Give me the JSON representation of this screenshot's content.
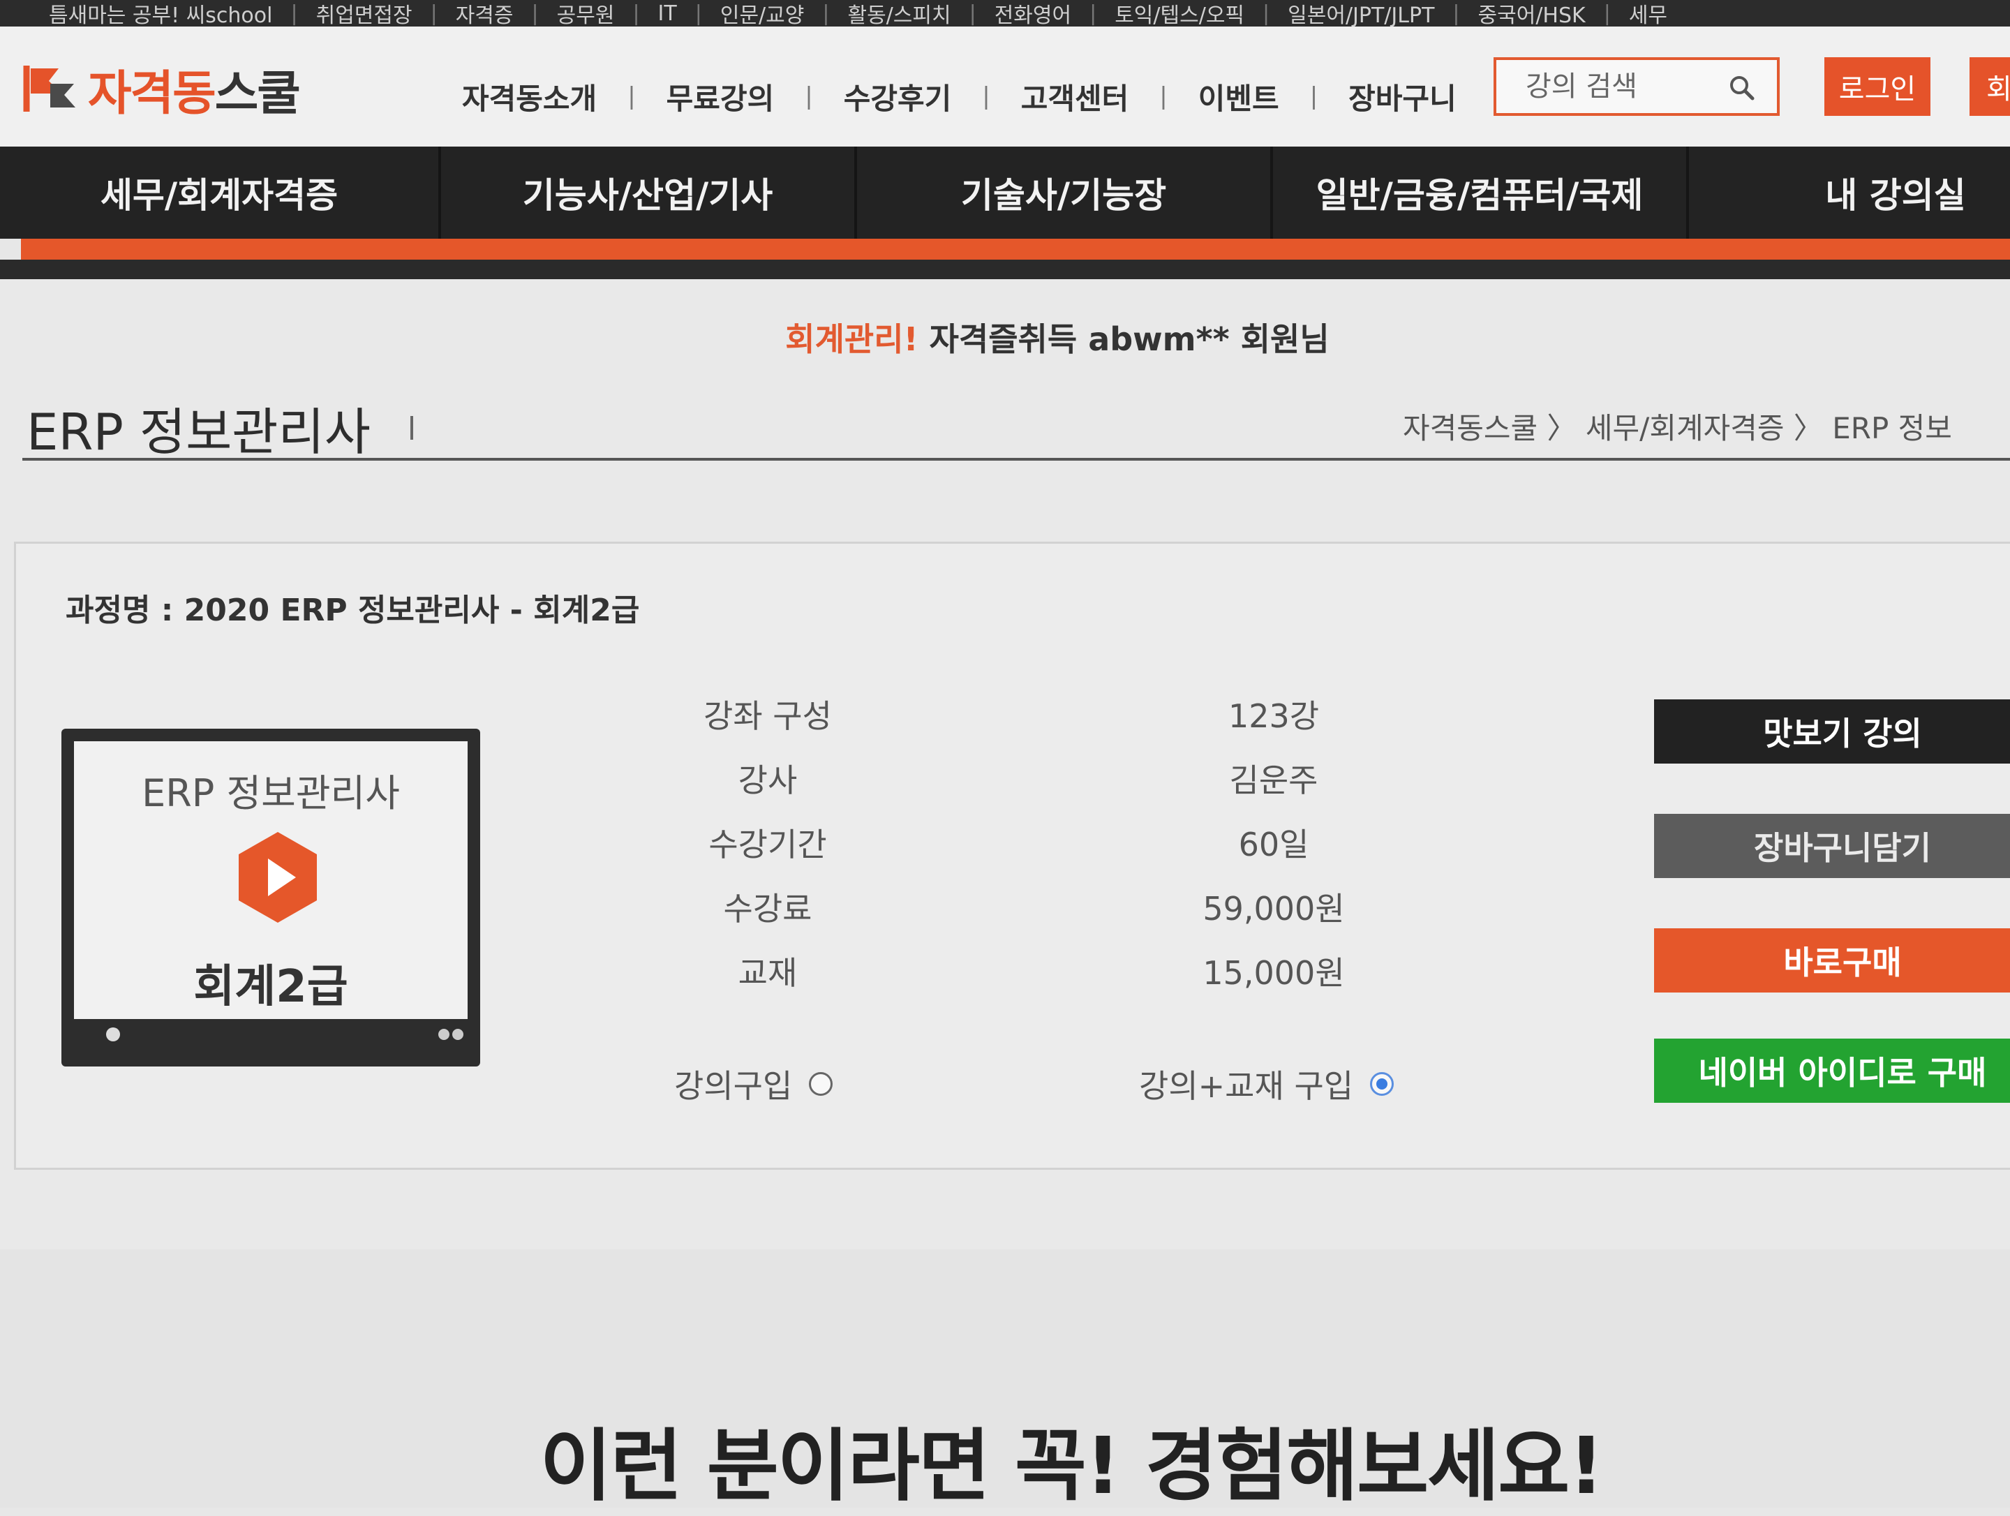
{
  "topbar": {
    "items": [
      "틈새마는 공부! 씨school",
      "취업면접장",
      "자격증",
      "공무원",
      "IT",
      "인문/교양",
      "활동/스피치",
      "전화영어",
      "토익/텝스/오픽",
      "일본어/JPT/JLPT",
      "중국어/HSK",
      "세무"
    ]
  },
  "header": {
    "logo_text_part1": "자격동",
    "logo_text_part2": "스쿨",
    "util_nav": [
      "자격동소개",
      "무료강의",
      "수강후기",
      "고객센터",
      "이벤트",
      "장바구니"
    ],
    "search_placeholder": "강의 검색",
    "login_label": "로그인",
    "join_label": "회"
  },
  "gnb": {
    "items": [
      "세무/회계자격증",
      "기능사/산업/기사",
      "기술사/기능장",
      "일반/금융/컴퓨터/국제",
      "내 강의실"
    ]
  },
  "welcome": {
    "highlight": "회계관리!",
    "text": " 자격즐취득 abwm** 회원님"
  },
  "page": {
    "title": "ERP 정보관리사",
    "breadcrumb": "자격동스쿨 〉 세무/회계자격증 〉 ERP 정보"
  },
  "course": {
    "name": "과정명 : 2020 ERP 정보관리사 - 회계2급",
    "thumb_title": "ERP 정보관리사",
    "thumb_sub": "회계2급",
    "info": [
      {
        "label": "강좌 구성",
        "value": "123강"
      },
      {
        "label": "강사",
        "value": "김운주"
      },
      {
        "label": "수강기간",
        "value": "60일"
      },
      {
        "label": "수강료",
        "value": "59,000원"
      },
      {
        "label": "교재",
        "value": "15,000원"
      }
    ],
    "option_lecture": "강의구입",
    "option_lecture_book": "강의+교재 구입",
    "selected_option": "강의+교재 구입"
  },
  "actions": {
    "preview": "맛보기 강의",
    "cart": "장바구니담기",
    "buy_now": "바로구매",
    "naver_buy": "네이버 아이디로 구매"
  },
  "promo": {
    "headline": "이런 분이라면 꼭! 경험해보세요!"
  },
  "colors": {
    "accent": "#e5532a",
    "nav_bg": "#232323",
    "naver_green": "#23a331"
  }
}
